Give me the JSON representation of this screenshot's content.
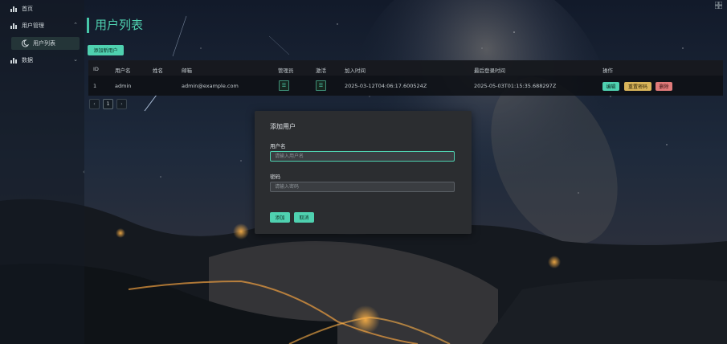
{
  "colors": {
    "accent": "#4fd1b0",
    "edit": "#4fd1b0",
    "reset": "#d9b45a",
    "delete": "#e07a7a",
    "modal_bg": "#2b2d30"
  },
  "sidebar": {
    "items": [
      {
        "label": "首页",
        "icon": "chart-icon"
      },
      {
        "label": "用户管理",
        "icon": "chart-icon",
        "expanded": true
      },
      {
        "label": "用户列表",
        "icon": "moon-icon"
      },
      {
        "label": "数据",
        "icon": "chart-icon",
        "expanded": false
      }
    ]
  },
  "main": {
    "title": "用户列表",
    "add_button": "添加新用户",
    "table": {
      "headers": [
        "ID",
        "用户名",
        "姓名",
        "邮箱",
        "管理员",
        "激活",
        "加入时间",
        "最后登录时间",
        "操作"
      ],
      "rows": [
        {
          "id": "1",
          "username": "admin",
          "name": "",
          "email": "admin@example.com",
          "is_admin": true,
          "active": true,
          "joined": "2025-03-12T04:06:17.600524Z",
          "last_login": "2025-05-03T01:15:35.688297Z",
          "actions": {
            "edit": "编辑",
            "reset": "重置密码",
            "delete": "删除"
          }
        }
      ]
    },
    "pager": {
      "prev": "‹",
      "page": "1",
      "next": "›"
    }
  },
  "modal": {
    "title": "添加用户",
    "username_label": "用户名",
    "username_placeholder": "请输入用户名",
    "password_label": "密码",
    "password_placeholder": "请输入密码",
    "submit": "添加",
    "cancel": "取消"
  }
}
